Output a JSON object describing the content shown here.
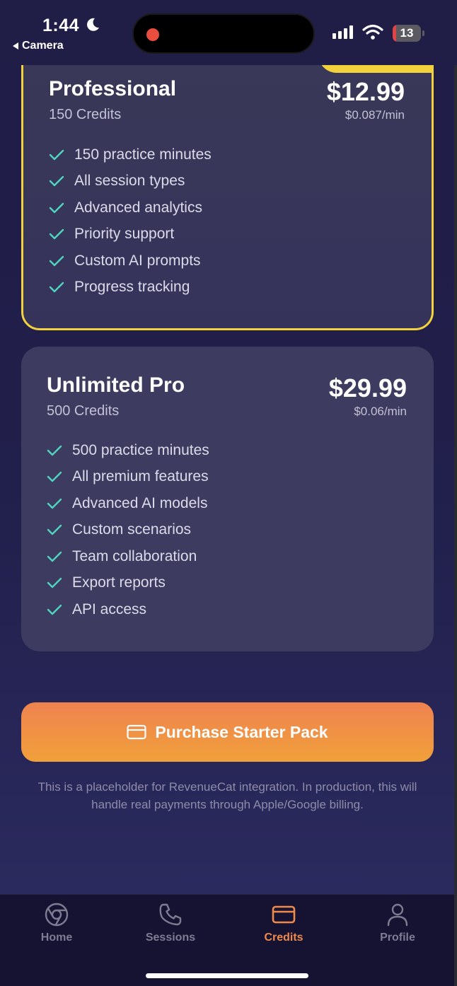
{
  "status_bar": {
    "time": "1:44",
    "back_app": "Camera",
    "battery": "13",
    "moon_icon": "moon-icon",
    "wifi_icon": "wifi-icon",
    "signal_icon": "cellular-signal-icon"
  },
  "plans": [
    {
      "name": "Professional",
      "credits": "150 Credits",
      "price": "$12.99",
      "rate": "$0.087/min",
      "highlight_color": "#f2d13c",
      "features": [
        "150 practice minutes",
        "All session types",
        "Advanced analytics",
        "Priority support",
        "Custom AI prompts",
        "Progress tracking"
      ]
    },
    {
      "name": "Unlimited Pro",
      "credits": "500 Credits",
      "price": "$29.99",
      "rate": "$0.06/min",
      "features": [
        "500 practice minutes",
        "All premium features",
        "Advanced AI models",
        "Custom scenarios",
        "Team collaboration",
        "Export reports",
        "API access"
      ]
    }
  ],
  "purchase": {
    "label": "Purchase Starter Pack",
    "icon": "credit-card-icon"
  },
  "note": "This is a placeholder for RevenueCat integration. In production, this will handle real payments through Apple/Google billing.",
  "tabs": [
    {
      "label": "Home",
      "icon": "chrome-logo-icon",
      "active": false
    },
    {
      "label": "Sessions",
      "icon": "phone-icon",
      "active": false
    },
    {
      "label": "Credits",
      "icon": "credit-card-icon",
      "active": true
    },
    {
      "label": "Profile",
      "icon": "person-icon",
      "active": false
    }
  ],
  "colors": {
    "accent": "#f08a4a",
    "check": "#4fd6c0",
    "highlight": "#f2d13c",
    "background": "#201e47"
  }
}
